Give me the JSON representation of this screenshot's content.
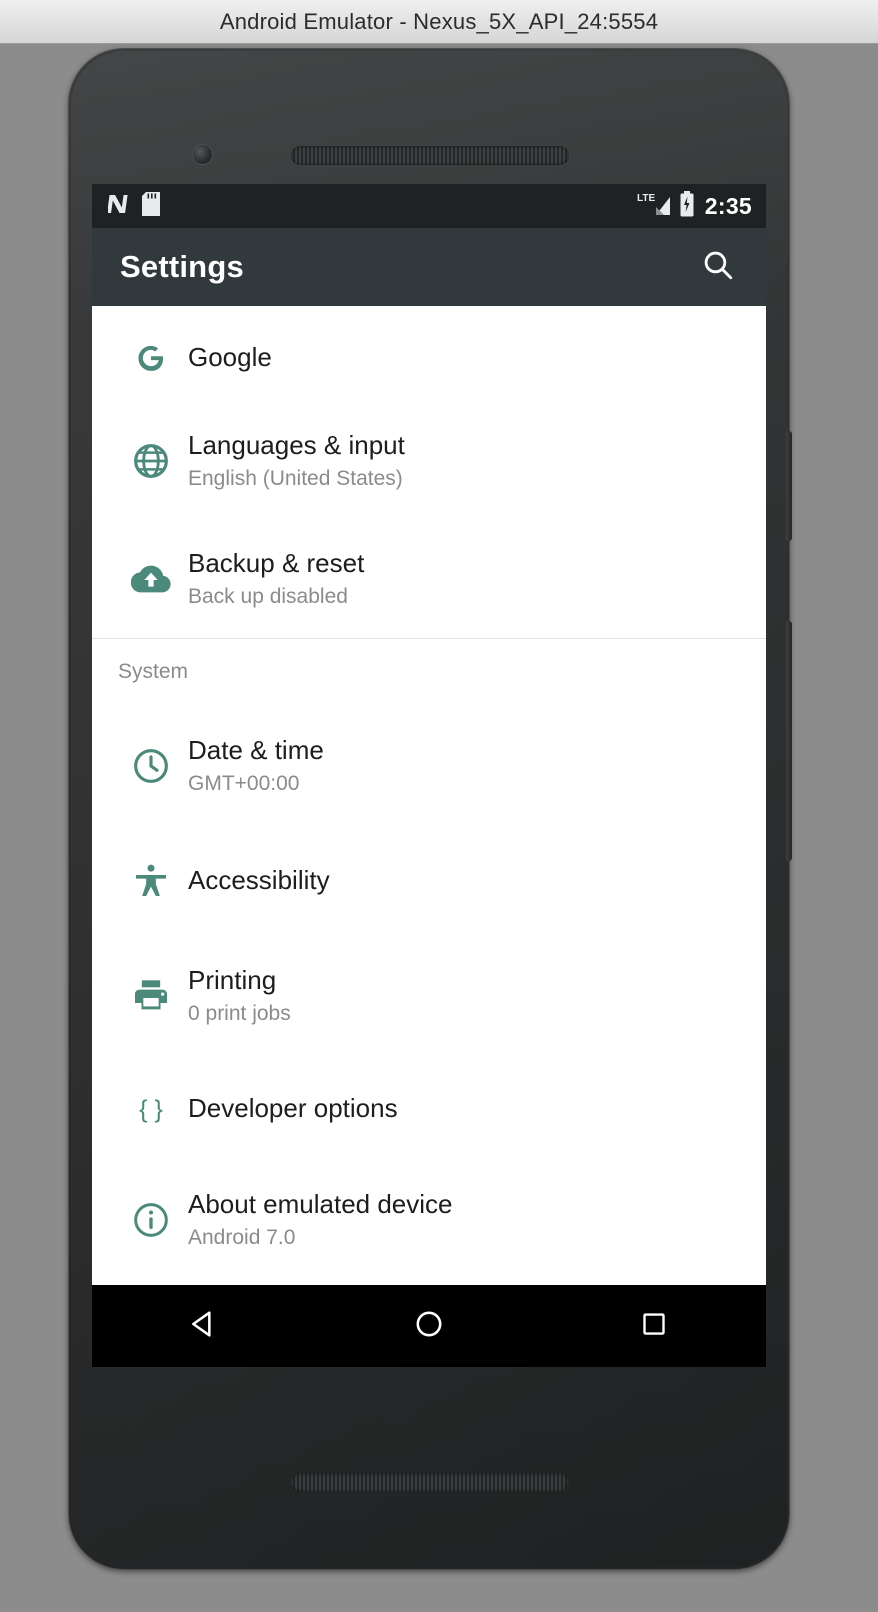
{
  "window": {
    "title": "Android Emulator - Nexus_5X_API_24:5554"
  },
  "status_bar": {
    "icons": [
      "android-n-icon",
      "sd-card-icon",
      "lte-signal-icon",
      "battery-charging-icon"
    ],
    "network_label": "LTE",
    "time": "2:35"
  },
  "toolbar": {
    "title": "Settings",
    "search_icon": "search-icon"
  },
  "settings": {
    "items": [
      {
        "icon": "google-g-icon",
        "title": "Google",
        "subtitle": ""
      },
      {
        "icon": "globe-icon",
        "title": "Languages & input",
        "subtitle": "English (United States)"
      },
      {
        "icon": "cloud-upload-icon",
        "title": "Backup & reset",
        "subtitle": "Back up disabled"
      }
    ],
    "system_section": {
      "header": "System",
      "items": [
        {
          "icon": "clock-icon",
          "title": "Date & time",
          "subtitle": "GMT+00:00"
        },
        {
          "icon": "accessibility-icon",
          "title": "Accessibility",
          "subtitle": ""
        },
        {
          "icon": "printer-icon",
          "title": "Printing",
          "subtitle": "0 print jobs"
        },
        {
          "icon": "braces-icon",
          "title": "Developer options",
          "subtitle": ""
        },
        {
          "icon": "info-circle-icon",
          "title": "About emulated device",
          "subtitle": "Android 7.0"
        }
      ]
    }
  },
  "highlight": {
    "target": "About emulated device",
    "color": "#dd4332"
  },
  "nav_bar": {
    "back": "back-triangle-icon",
    "home": "home-circle-icon",
    "recents": "recents-square-icon"
  },
  "colors": {
    "accent_teal": "#4b8a7b",
    "toolbar_bg": "#31393c",
    "status_bg": "#1f2223",
    "highlight_red": "#dd4332"
  }
}
